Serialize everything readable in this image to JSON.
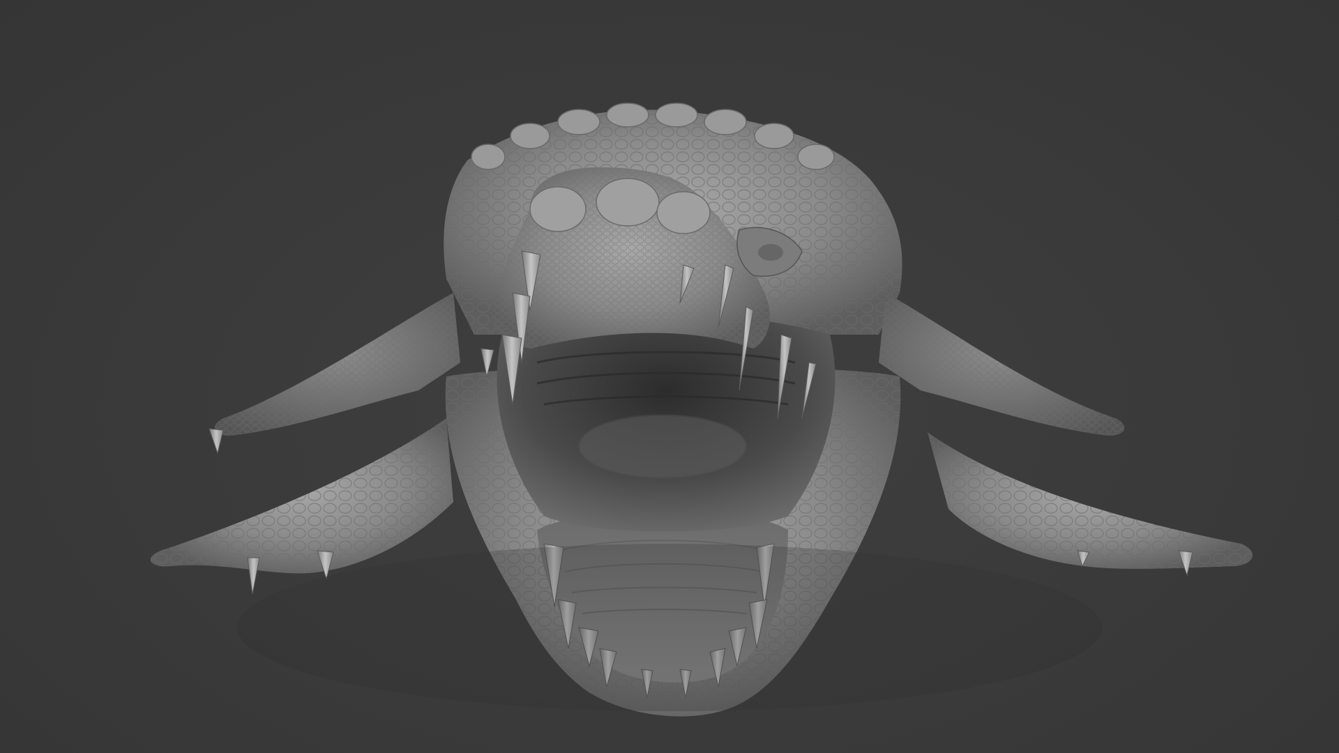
{
  "viewport": {
    "background_color": "#3a3a3a",
    "model_color": "#8c8c8c",
    "subject": "crocodile-sculpt"
  }
}
